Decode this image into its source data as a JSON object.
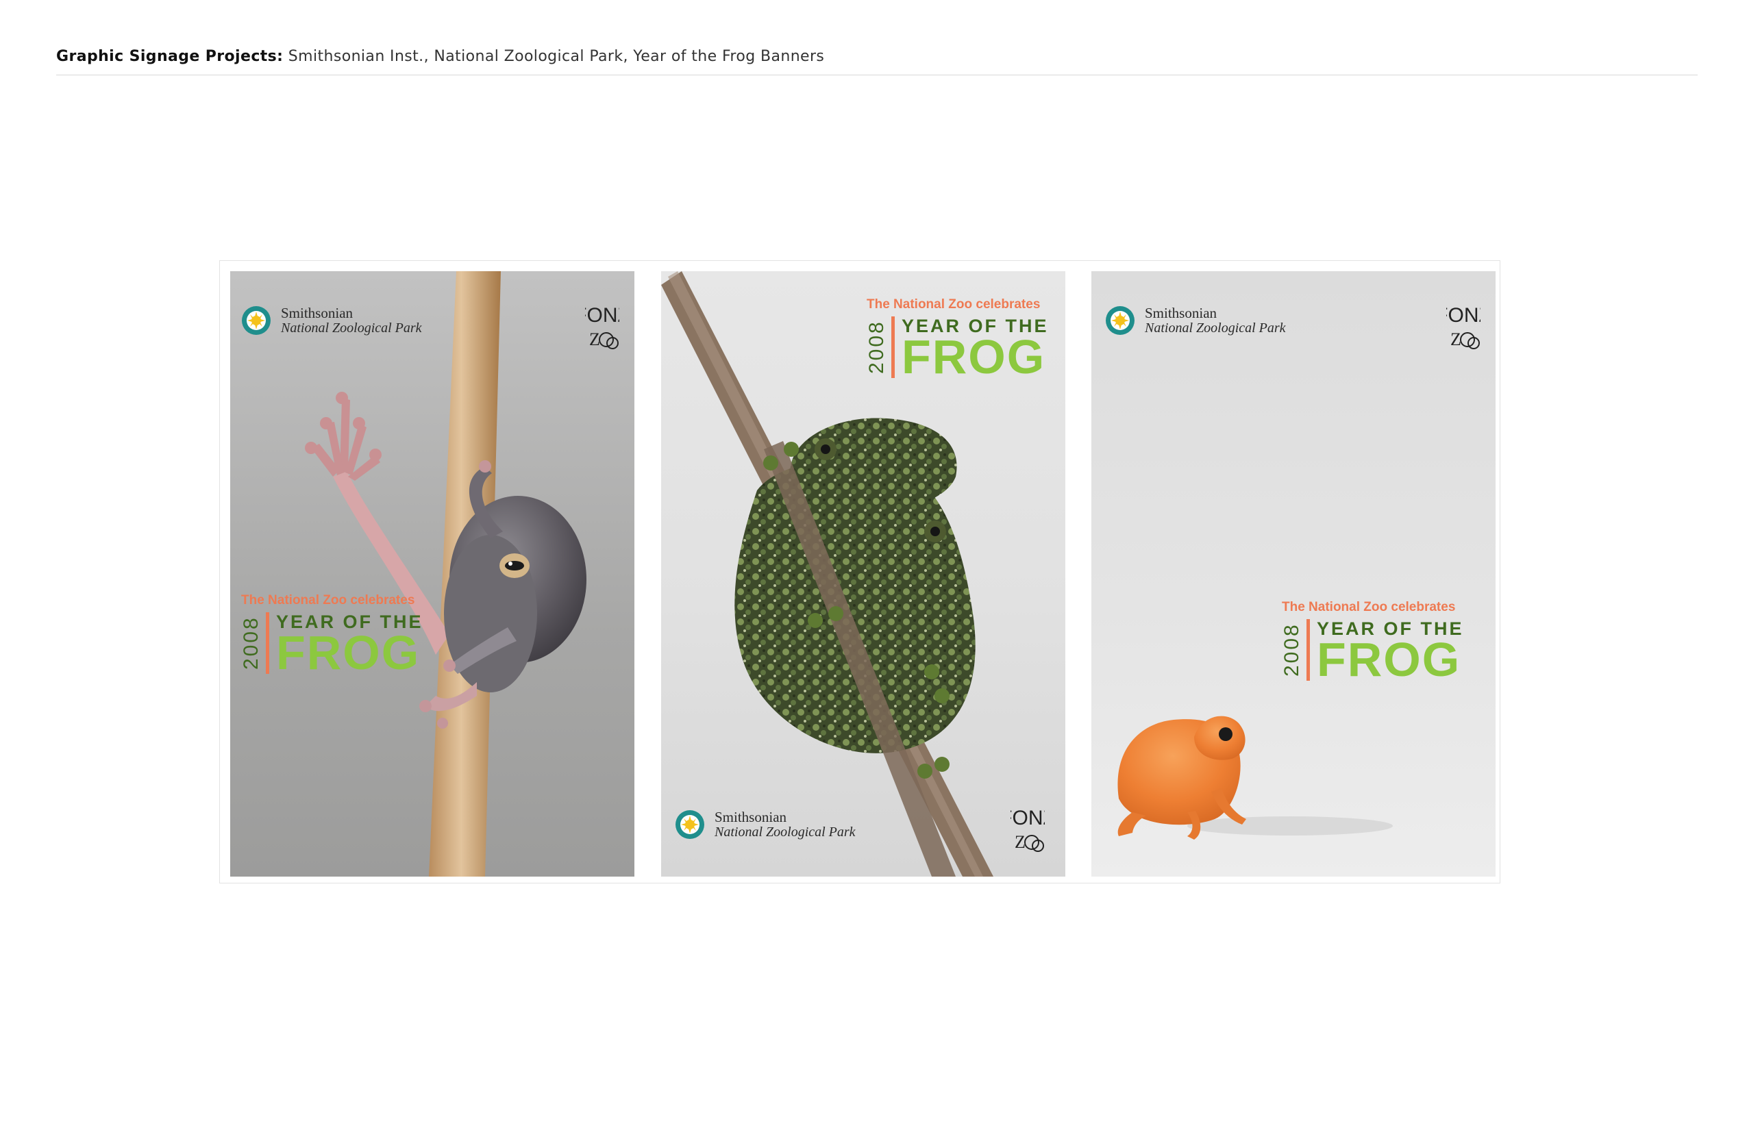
{
  "header": {
    "label": "Graphic Signage Projects:",
    "description": "Smithsonian Inst., National Zoological Park, Year of the Frog Banners"
  },
  "banners": [
    {
      "logo": {
        "name": "Smithsonian",
        "park": "National Zoological Park"
      },
      "fonz": "FONZ",
      "celebrates": "The National Zoo celebrates",
      "year": "2008",
      "tagline": "YEAR OF THE",
      "frog": "FROG",
      "subject": "white tree frog climbing a wooden pole"
    },
    {
      "logo": {
        "name": "Smithsonian",
        "park": "National Zoological Park"
      },
      "fonz": "FONZ",
      "celebrates": "The National Zoo celebrates",
      "year": "2008",
      "tagline": "YEAR OF THE",
      "frog": "FROG",
      "subject": "mossy green frog clinging to a branch"
    },
    {
      "logo": {
        "name": "Smithsonian",
        "park": "National Zoological Park"
      },
      "fonz": "FONZ",
      "celebrates": "The National Zoo celebrates",
      "year": "2008",
      "tagline": "YEAR OF THE",
      "frog": "FROG",
      "subject": "small orange frog"
    }
  ],
  "colors": {
    "accent_orange": "#ee7a52",
    "frog_green": "#8cc83f",
    "dark_green": "#3f6b1f"
  }
}
